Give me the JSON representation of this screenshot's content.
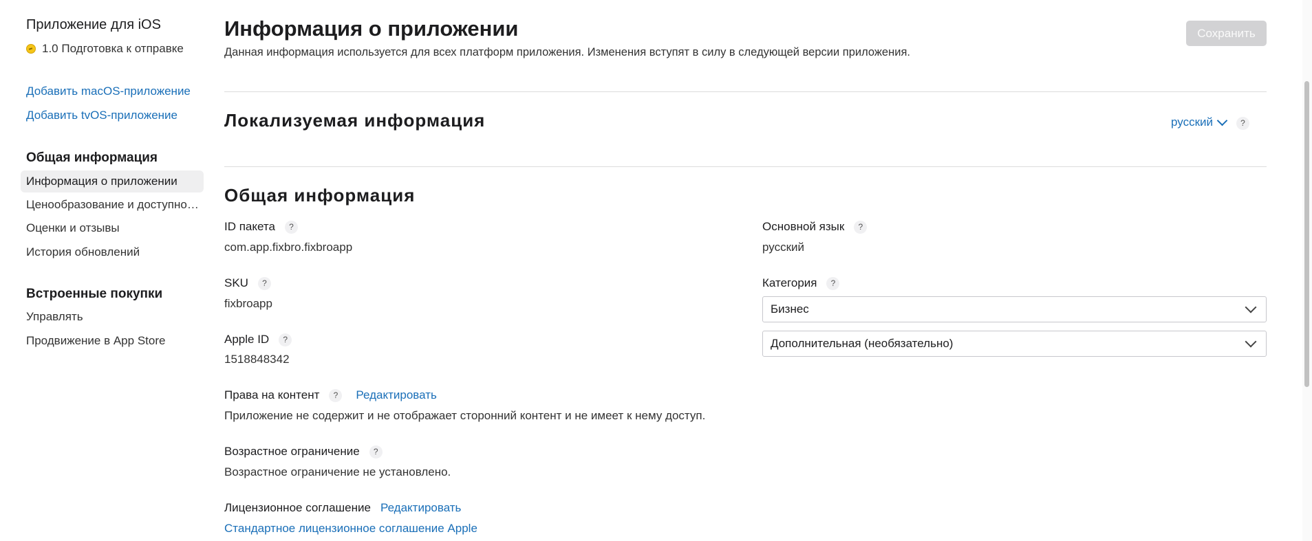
{
  "sidebar": {
    "app_title": "Приложение для iOS",
    "status": "1.0 Подготовка к отправке",
    "links": [
      "Добавить macOS-приложение",
      "Добавить tvOS-приложение"
    ],
    "general_section": {
      "title": "Общая информация",
      "items": [
        "Информация о приложении",
        "Ценообразование и доступность",
        "Оценки и отзывы",
        "История обновлений"
      ]
    },
    "purchases_section": {
      "title": "Встроенные покупки",
      "items": [
        "Управлять",
        "Продвижение в App Store"
      ]
    }
  },
  "header": {
    "title": "Информация о приложении",
    "subtitle": "Данная информация используется для всех платформ приложения. Изменения вступят в силу в следующей версии приложения.",
    "save_label": "Сохранить"
  },
  "localizable": {
    "title": "Локализуемая информация",
    "language": "русский",
    "help": "?"
  },
  "general": {
    "title": "Общая информация",
    "help": "?",
    "bundle_id": {
      "label": "ID пакета",
      "value": "com.app.fixbro.fixbroapp"
    },
    "sku": {
      "label": "SKU",
      "value": "fixbroapp"
    },
    "apple_id": {
      "label": "Apple ID",
      "value": "1518848342"
    },
    "content_rights": {
      "label": "Права на контент",
      "edit": "Редактировать",
      "value": "Приложение не содержит и не отображает сторонний контент и не имеет к нему доступ."
    },
    "age_rating": {
      "label": "Возрастное ограничение",
      "value": "Возрастное ограничение не установлено."
    },
    "license": {
      "label": "Лицензионное соглашение",
      "edit": "Редактировать",
      "value": "Стандартное лицензионное соглашение Apple"
    },
    "primary_language": {
      "label": "Основной язык",
      "value": "русский"
    },
    "category": {
      "label": "Категория",
      "primary": "Бизнес",
      "secondary": "Дополнительная (необязательно)"
    }
  },
  "colors": {
    "accent": "#1a6fb8",
    "status_dot": "#f5c518",
    "save_disabled": "#d2d2d4",
    "sidebar_active": "#efeff0"
  }
}
